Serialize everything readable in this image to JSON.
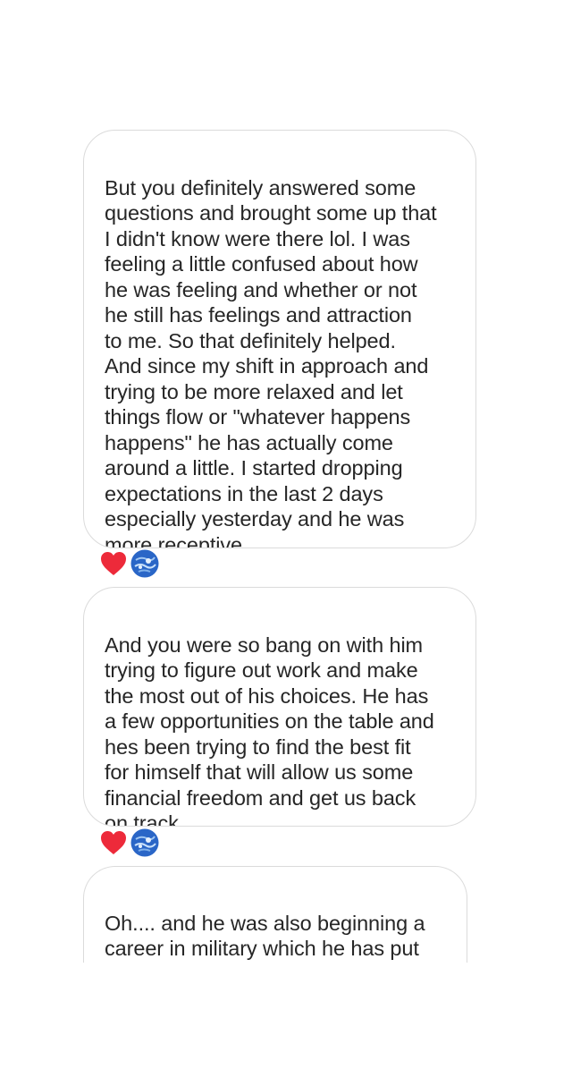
{
  "messages": [
    {
      "text": "But you definitely answered some\nquestions and brought some up that\nI didn't know were there lol. I was\nfeeling a little confused about how\nhe was feeling and whether or not\nhe still has feelings and attraction\nto me. So that definitely helped.\nAnd since my shift in approach and\ntrying to be more relaxed and let\nthings flow or \"whatever happens\nhappens\" he has actually come\naround a little. I started dropping\nexpectations in the last 2 days\nespecially yesterday and he was\nmore receptive.",
      "reaction": "heart-icon"
    },
    {
      "text": "And you were so bang on with him\ntrying to figure out work and make\nthe most out of his choices. He has\na few opportunities on the table and\nhes been trying to find the best fit\nfor himself that will allow us some\nfinancial freedom and get us back\non track.",
      "reaction": "heart-icon"
    },
    {
      "text": "Oh.... and he was also beginning a\ncareer in military which he has put\non hold to deal with issues with his",
      "reaction": null
    }
  ],
  "colors": {
    "bubble_border": "#dbdbdb",
    "text": "#262626",
    "heart": "#ed2a3a",
    "avatar": "#2a66c7"
  }
}
